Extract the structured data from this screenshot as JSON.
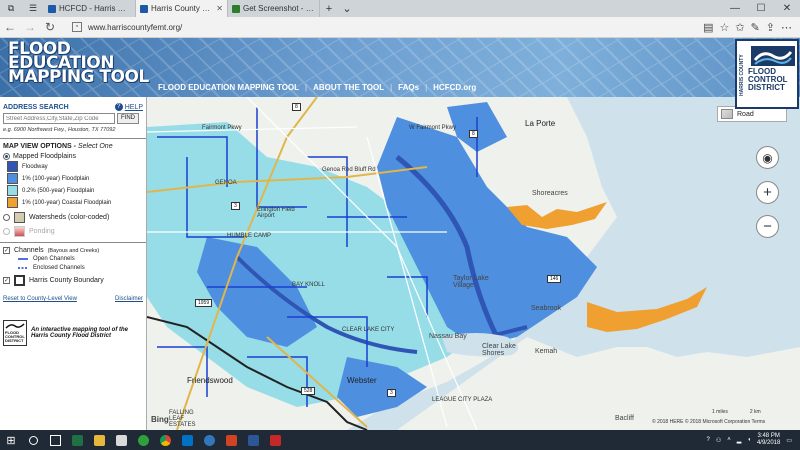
{
  "browser": {
    "tabs": [
      {
        "label": "HCFCD - Harris County Floo",
        "active": false,
        "color": "#1b5aa6"
      },
      {
        "label": "Harris County Flood Edu",
        "active": true,
        "color": "#1b5aa6"
      },
      {
        "label": "Get Screenshot - Microsoft",
        "active": false,
        "color": "#2d7d2d"
      }
    ],
    "url": "www.harriscountyfemt.org/"
  },
  "header": {
    "logo_lines": [
      "FLOOD",
      "EDUCATION",
      "MAPPING TOOL"
    ],
    "nav": [
      "FLOOD EDUCATION MAPPING TOOL",
      "ABOUT THE TOOL",
      "FAQs",
      "HCFCD.org"
    ],
    "badge_side": "HARRIS COUNTY",
    "badge_lines": [
      "FLOOD",
      "CONTROL",
      "DISTRICT"
    ]
  },
  "sidebar": {
    "address_title": "ADDRESS SEARCH",
    "help_label": "HELP",
    "address_placeholder": "Street Address,City,State,Zip Code",
    "find_label": "FIND",
    "example": "e.g. 6900 Northwest Fwy., Houston, TX 77092",
    "map_view_title": "MAP VIEW OPTIONS -",
    "select_one": "Select One",
    "mapped_floodplains": "Mapped Floodplains",
    "legend": [
      {
        "label": "Floodway",
        "color": "#2f55b5"
      },
      {
        "label": "1% (100-year) Floodplain",
        "color": "#4f8fe0"
      },
      {
        "label": "0.2% (500-year) Floodplain",
        "color": "#96dde8"
      },
      {
        "label": "1% (100-year) Coastal Floodplain",
        "color": "#f0a030"
      }
    ],
    "watersheds": "Watersheds (color-coded)",
    "ponding": "Ponding",
    "channels": "Channels",
    "channels_sub": "(Bayous and Creeks)",
    "open_channels": "Open Channels",
    "enclosed_channels": "Enclosed Channels",
    "boundary": "Harris County Boundary",
    "reset_link": "Reset to County-Level View",
    "disclaimer_link": "Disclaimer",
    "footer_tag_1": "An interactive mapping tool of the",
    "footer_tag_2": "Harris County Flood District",
    "footer_logo_lines": [
      "FLOOD",
      "CONTROL",
      "DISTRICT"
    ]
  },
  "map": {
    "layer_select": "Road",
    "labels": [
      {
        "text": "Fairmont Pkwy",
        "cls": ""
      },
      {
        "text": "W Fairmont Pkwy",
        "cls": ""
      },
      {
        "text": "La Porte",
        "cls": "big"
      },
      {
        "text": "Genoa Red Bluff Rd",
        "cls": ""
      },
      {
        "text": "GENOA",
        "cls": ""
      },
      {
        "text": "Ellington Field Airport",
        "cls": ""
      },
      {
        "text": "HUMBLE CAMP",
        "cls": ""
      },
      {
        "text": "Shoreacres",
        "cls": "med"
      },
      {
        "text": "Taylor Lake Village",
        "cls": "med"
      },
      {
        "text": "Seabrook",
        "cls": "med"
      },
      {
        "text": "Nassau Bay",
        "cls": "med"
      },
      {
        "text": "Clear Lake Shores",
        "cls": "med"
      },
      {
        "text": "Kemah",
        "cls": "med"
      },
      {
        "text": "Friendswood",
        "cls": "big"
      },
      {
        "text": "Webster",
        "cls": "big"
      },
      {
        "text": "Bacliff",
        "cls": "med"
      },
      {
        "text": "BAY KNOLL",
        "cls": ""
      },
      {
        "text": "CLEAR LAKE CITY",
        "cls": ""
      },
      {
        "text": "FALLING LEAF ESTATES",
        "cls": ""
      },
      {
        "text": "LEAGUE CITY PLAZA",
        "cls": ""
      }
    ],
    "shields": [
      "8",
      "3",
      "1959",
      "528",
      "3",
      "146",
      "8"
    ],
    "scale": [
      "1 miles",
      "2 km"
    ],
    "copyright": "© 2018 HERE © 2018 Microsoft Corporation Terms",
    "attribution": "Bing"
  },
  "taskbar": {
    "time": "3:48 PM",
    "date": "4/9/2018"
  }
}
